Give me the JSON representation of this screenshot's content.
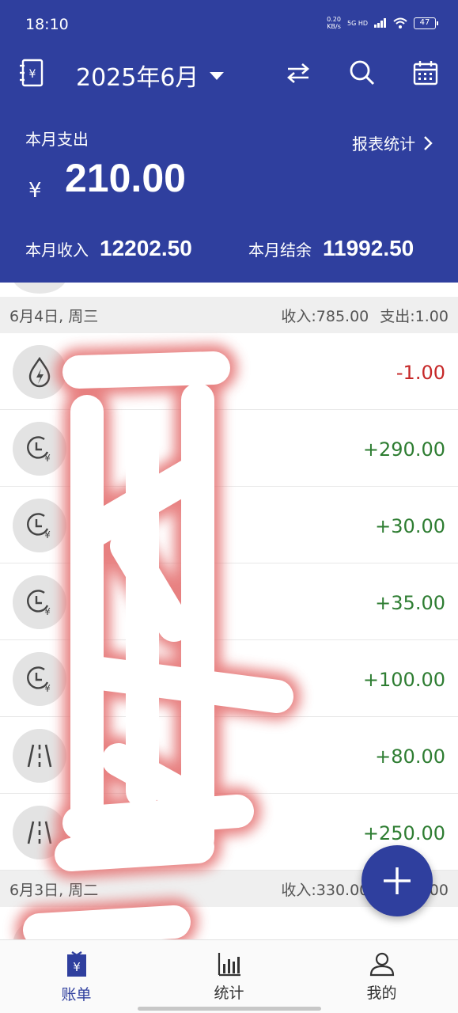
{
  "status_bar": {
    "time": "18:10",
    "speed": "0.20\nKB/s",
    "network": "5G HD",
    "battery": "47"
  },
  "header": {
    "month": "2025年6月",
    "expense_label": "本月支出",
    "currency": "¥",
    "expense_amount": "210.00",
    "report_link": "报表统计",
    "income_label": "本月收入",
    "income_amount": "12202.50",
    "balance_label": "本月结余",
    "balance_amount": "11992.50"
  },
  "days": [
    {
      "date": "6月4日, 周三",
      "income": "收入:785.00",
      "expense": "支出:1.00",
      "entries": [
        {
          "icon": "utility-icon",
          "amount": "-1.00"
        },
        {
          "icon": "clock-yen-icon",
          "amount": "+290.00"
        },
        {
          "icon": "clock-yen-icon",
          "amount": "+30.00"
        },
        {
          "icon": "clock-yen-icon",
          "amount": "+35.00"
        },
        {
          "icon": "clock-yen-icon",
          "amount": "+100.00"
        },
        {
          "icon": "road-icon",
          "amount": "+80.00"
        },
        {
          "icon": "road-icon",
          "amount": "+250.00"
        }
      ]
    },
    {
      "date": "6月3日, 周二",
      "income": "收入:330.00",
      "expense": "支出:0.00"
    }
  ],
  "nav": {
    "bill": "账单",
    "stats": "统计",
    "mine": "我的"
  },
  "colors": {
    "primary": "#2f3f9e",
    "income": "#2e7d32",
    "expense": "#c62828"
  }
}
